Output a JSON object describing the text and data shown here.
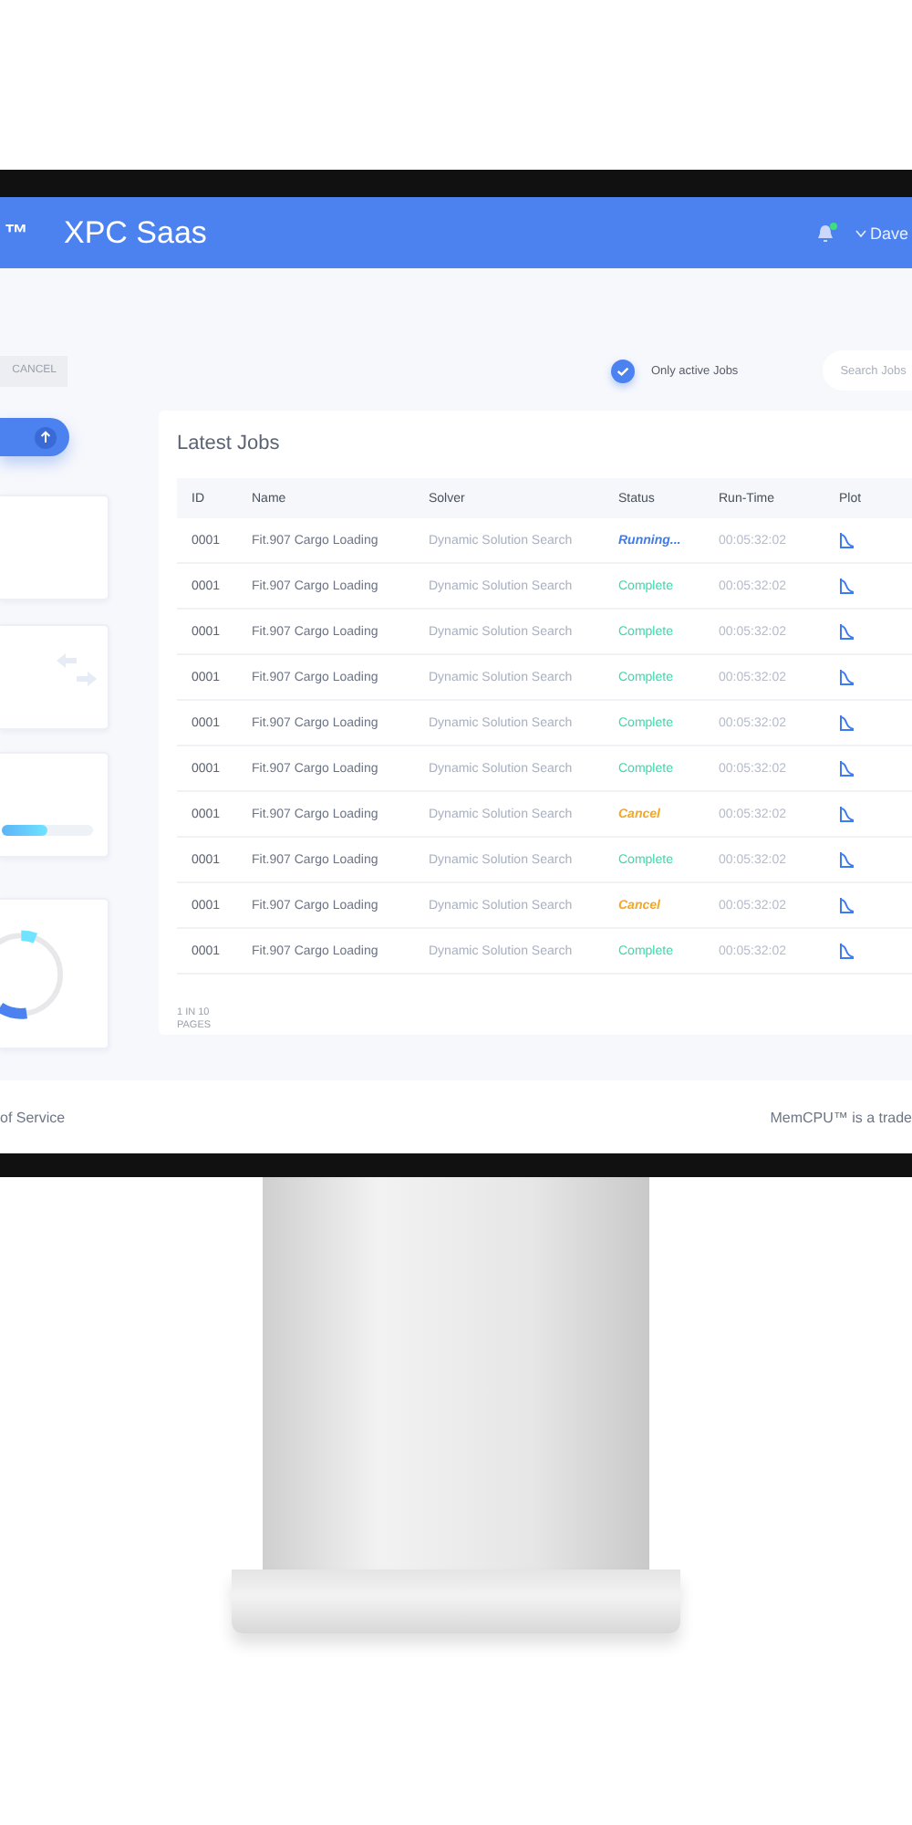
{
  "header": {
    "logo": "™",
    "title": "XPC Saas",
    "notification_dot": true,
    "user": "Dave"
  },
  "toolbar": {
    "cancel": "CANCEL",
    "only_active": {
      "label": "Only active Jobs",
      "checked": true
    },
    "search": {
      "placeholder": "Search Jobs"
    }
  },
  "sidebar": {
    "progress": {
      "level": 0.5
    }
  },
  "jobs": {
    "title": "Latest Jobs",
    "columns": [
      "ID",
      "Name",
      "Solver",
      "Status",
      "Run-Time",
      "Plot"
    ],
    "rows": [
      {
        "id": "0001",
        "name": "Fit.907 Cargo Loading",
        "solver": "Dynamic Solution Search",
        "status": {
          "kind": "running",
          "text": "Running..."
        },
        "runtime": "00:05:32:02"
      },
      {
        "id": "0001",
        "name": "Fit.907 Cargo Loading",
        "solver": "Dynamic Solution Search",
        "status": {
          "kind": "complete",
          "text": "Complete"
        },
        "runtime": "00:05:32:02"
      },
      {
        "id": "0001",
        "name": "Fit.907 Cargo Loading",
        "solver": "Dynamic Solution Search",
        "status": {
          "kind": "complete",
          "text": "Complete"
        },
        "runtime": "00:05:32:02"
      },
      {
        "id": "0001",
        "name": "Fit.907 Cargo Loading",
        "solver": "Dynamic Solution Search",
        "status": {
          "kind": "complete",
          "text": "Complete"
        },
        "runtime": "00:05:32:02"
      },
      {
        "id": "0001",
        "name": "Fit.907 Cargo Loading",
        "solver": "Dynamic Solution Search",
        "status": {
          "kind": "complete",
          "text": "Complete"
        },
        "runtime": "00:05:32:02"
      },
      {
        "id": "0001",
        "name": "Fit.907 Cargo Loading",
        "solver": "Dynamic Solution Search",
        "status": {
          "kind": "complete",
          "text": "Complete"
        },
        "runtime": "00:05:32:02"
      },
      {
        "id": "0001",
        "name": "Fit.907 Cargo Loading",
        "solver": "Dynamic Solution Search",
        "status": {
          "kind": "cancel",
          "text": "Cancel"
        },
        "runtime": "00:05:32:02"
      },
      {
        "id": "0001",
        "name": "Fit.907 Cargo Loading",
        "solver": "Dynamic Solution Search",
        "status": {
          "kind": "complete",
          "text": "Complete"
        },
        "runtime": "00:05:32:02"
      },
      {
        "id": "0001",
        "name": "Fit.907 Cargo Loading",
        "solver": "Dynamic Solution Search",
        "status": {
          "kind": "cancel",
          "text": "Cancel"
        },
        "runtime": "00:05:32:02"
      },
      {
        "id": "0001",
        "name": "Fit.907 Cargo Loading",
        "solver": "Dynamic Solution Search",
        "status": {
          "kind": "complete",
          "text": "Complete"
        },
        "runtime": "00:05:32:02"
      }
    ],
    "pagination": "1 IN 10 PAGES"
  },
  "footer": {
    "left": "of Service",
    "right": "MemCPU™ is a trade"
  }
}
